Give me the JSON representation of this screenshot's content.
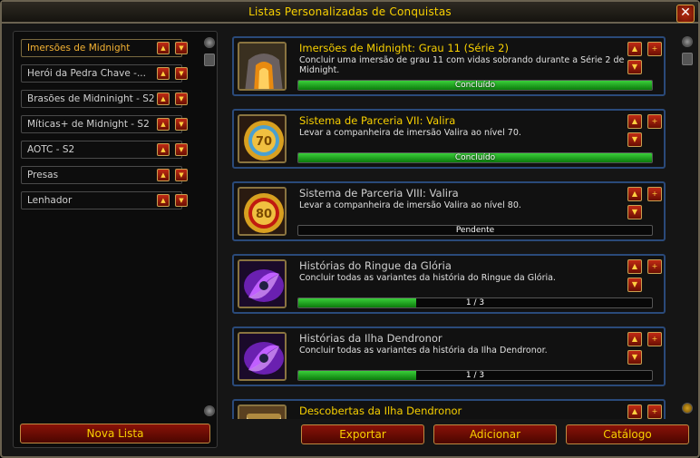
{
  "window": {
    "title": "Listas Personalizadas de Conquistas",
    "close_label": "✕"
  },
  "lists": [
    {
      "label": "Imersões de Midnight",
      "active": true
    },
    {
      "label": "Herói da Pedra Chave -...",
      "active": false
    },
    {
      "label": "Brasões de Midninight - S2",
      "active": false
    },
    {
      "label": "Míticas+ de Midnight - S2",
      "active": false
    },
    {
      "label": "AOTC - S2",
      "active": false
    },
    {
      "label": "Presas",
      "active": false
    },
    {
      "label": "Lenhador",
      "active": false
    }
  ],
  "buttons": {
    "new_list": "Nova Lista",
    "export": "Exportar",
    "add": "Adicionar",
    "catalog": "Catálogo",
    "up_glyph": "▲",
    "down_glyph": "▼",
    "plus_glyph": "+"
  },
  "achievements": [
    {
      "name": "Imersões de Midnight: Grau 11 (Série 2)",
      "desc": "Concluir uma imersão de grau 11 com vidas sobrando durante a Série 2 de Midnight.",
      "status": "Concluído",
      "progress": 1.0,
      "name_color": "#f8d000",
      "icon": "cave-gate-icon"
    },
    {
      "name": "Sistema de Parceria VII: Valira",
      "desc": "Levar a companheira de imersão Valira ao nível 70.",
      "status": "Concluído",
      "progress": 1.0,
      "name_color": "#f8d000",
      "icon": "badge-70-icon"
    },
    {
      "name": "Sistema de Parceria VIII: Valira",
      "desc": "Levar a companheira de imersão Valira ao nível 80.",
      "status": "Pendente",
      "progress": 0.0,
      "name_color": "#d0d0d0",
      "icon": "badge-80-icon"
    },
    {
      "name": "Histórias do Ringue da Glória",
      "desc": "Concluir todas as variantes da história do Ringue da Glória.",
      "status": "1 / 3",
      "progress": 0.333,
      "name_color": "#d0d0d0",
      "icon": "purple-vortex-icon"
    },
    {
      "name": "Histórias da Ilha Dendronor",
      "desc": "Concluir todas as variantes da história da Ilha Dendronor.",
      "status": "1 / 3",
      "progress": 0.333,
      "name_color": "#d0d0d0",
      "icon": "purple-vortex-icon"
    },
    {
      "name": "Descobertas da Ilha Dendronor",
      "desc": "",
      "status": "",
      "progress": 0.0,
      "name_color": "#f8d000",
      "icon": "scroll-icon"
    }
  ]
}
